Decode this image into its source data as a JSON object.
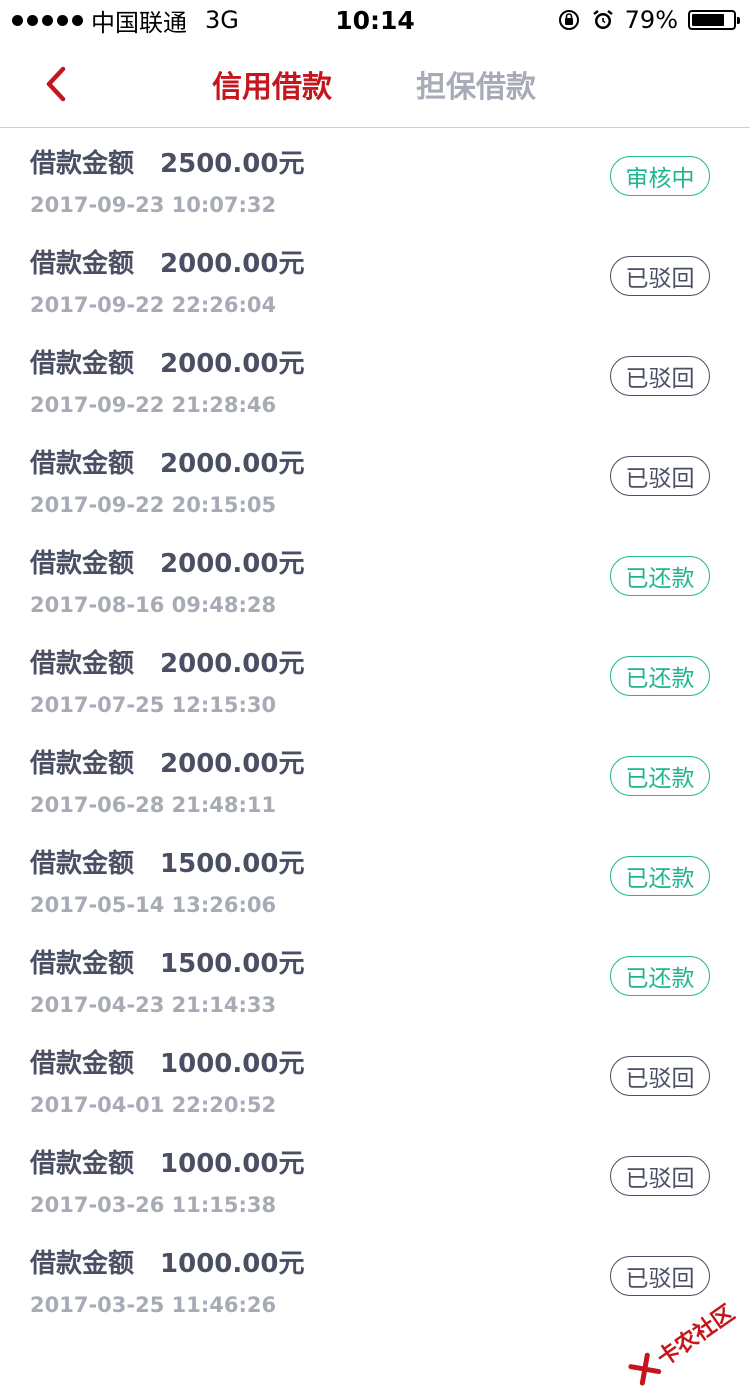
{
  "status_bar": {
    "carrier": "中国联通",
    "network": "3G",
    "time": "10:14",
    "battery_text": "79%",
    "battery_level": 0.79
  },
  "nav": {
    "tab_credit": "信用借款",
    "tab_guarantee": "担保借款"
  },
  "loans": [
    {
      "label": "借款金额",
      "amount": "2500.00元",
      "date": "2017-09-23 10:07:32",
      "status": "审核中",
      "status_color": "green"
    },
    {
      "label": "借款金额",
      "amount": "2000.00元",
      "date": "2017-09-22 22:26:04",
      "status": "已驳回",
      "status_color": "gray"
    },
    {
      "label": "借款金额",
      "amount": "2000.00元",
      "date": "2017-09-22 21:28:46",
      "status": "已驳回",
      "status_color": "gray"
    },
    {
      "label": "借款金额",
      "amount": "2000.00元",
      "date": "2017-09-22 20:15:05",
      "status": "已驳回",
      "status_color": "gray"
    },
    {
      "label": "借款金额",
      "amount": "2000.00元",
      "date": "2017-08-16 09:48:28",
      "status": "已还款",
      "status_color": "green"
    },
    {
      "label": "借款金额",
      "amount": "2000.00元",
      "date": "2017-07-25 12:15:30",
      "status": "已还款",
      "status_color": "green"
    },
    {
      "label": "借款金额",
      "amount": "2000.00元",
      "date": "2017-06-28 21:48:11",
      "status": "已还款",
      "status_color": "green"
    },
    {
      "label": "借款金额",
      "amount": "1500.00元",
      "date": "2017-05-14 13:26:06",
      "status": "已还款",
      "status_color": "green"
    },
    {
      "label": "借款金额",
      "amount": "1500.00元",
      "date": "2017-04-23 21:14:33",
      "status": "已还款",
      "status_color": "green"
    },
    {
      "label": "借款金额",
      "amount": "1000.00元",
      "date": "2017-04-01 22:20:52",
      "status": "已驳回",
      "status_color": "gray"
    },
    {
      "label": "借款金额",
      "amount": "1000.00元",
      "date": "2017-03-26 11:15:38",
      "status": "已驳回",
      "status_color": "gray"
    },
    {
      "label": "借款金额",
      "amount": "1000.00元",
      "date": "2017-03-25 11:46:26",
      "status": "已驳回",
      "status_color": "gray"
    }
  ],
  "watermark": {
    "text": "卡农社区"
  },
  "colors": {
    "accent": "#c4161c",
    "green": "#1fb58f",
    "text": "#4a4f63",
    "muted": "#a7abb5"
  }
}
